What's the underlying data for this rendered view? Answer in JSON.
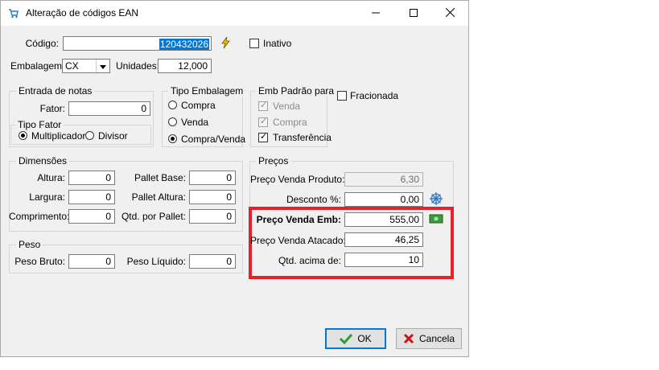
{
  "window": {
    "title": "Alteração de códigos EAN"
  },
  "header": {
    "codigo_label": "Código:",
    "codigo_value": "120432026",
    "inativo_label": "Inativo",
    "embalagem_label": "Embalagem:",
    "embalagem_value": "CX",
    "unidades_label": "Unidades:",
    "unidades_value": "12,000",
    "fracionada_label": "Fracionada"
  },
  "entrada_notas": {
    "title": "Entrada de notas",
    "fator_label": "Fator:",
    "fator_value": "0",
    "tipo_fator_title": "Tipo Fator",
    "multiplicador_label": "Multiplicador",
    "divisor_label": "Divisor"
  },
  "tipo_embalagem": {
    "title": "Tipo Embalagem",
    "compra_label": "Compra",
    "venda_label": "Venda",
    "compra_venda_label": "Compra/Venda"
  },
  "emb_padrao": {
    "title": "Emb Padrão para",
    "venda_label": "Venda",
    "compra_label": "Compra",
    "transferencia_label": "Transferência"
  },
  "dimensoes": {
    "title": "Dimensões",
    "altura_label": "Altura:",
    "altura_value": "0",
    "largura_label": "Largura:",
    "largura_value": "0",
    "comprimento_label": "Comprimento:",
    "comprimento_value": "0",
    "pallet_base_label": "Pallet Base:",
    "pallet_base_value": "0",
    "pallet_altura_label": "Pallet Altura:",
    "pallet_altura_value": "0",
    "qtd_pallet_label": "Qtd. por Pallet:",
    "qtd_pallet_value": "0"
  },
  "peso": {
    "title": "Peso",
    "bruto_label": "Peso Bruto:",
    "bruto_value": "0",
    "liquido_label": "Peso Líquido:",
    "liquido_value": "0"
  },
  "precos": {
    "title": "Preços",
    "venda_produto_label": "Preço Venda Produto:",
    "venda_produto_value": "6,30",
    "desconto_label": "Desconto %:",
    "desconto_value": "0,00",
    "venda_emb_label": "Preço Venda Emb:",
    "venda_emb_value": "555,00",
    "venda_atacado_label": "Preço Venda Atacado:",
    "venda_atacado_value": "46,25",
    "qtd_acima_label": "Qtd. acima de:",
    "qtd_acima_value": "10"
  },
  "buttons": {
    "ok_label": "OK",
    "cancel_label": "Cancela"
  },
  "colors": {
    "highlight": "#e8202a",
    "selection": "#0078d7",
    "ok_check": "#2e9e2e",
    "cancel_x": "#c8161d"
  },
  "icons": [
    "cart-icon",
    "lightning-icon",
    "discount-icon",
    "money-icon",
    "check-icon",
    "x-icon"
  ]
}
